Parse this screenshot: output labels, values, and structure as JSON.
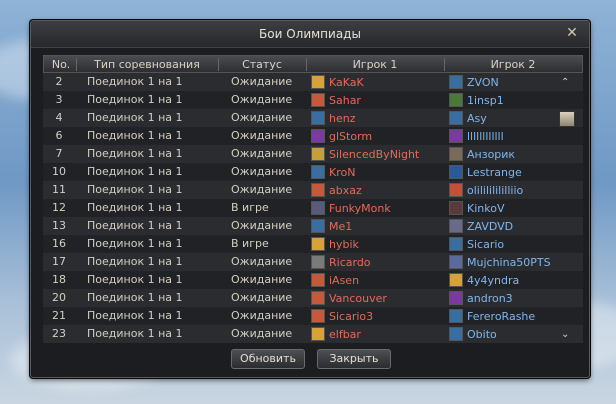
{
  "window": {
    "title": "Бои Олимпиады",
    "close_glyph": "✕"
  },
  "buttons": {
    "refresh": "Обновить",
    "close": "Закрыть"
  },
  "columns": [
    "No.",
    "Тип соревнования",
    "Статус",
    "Игрок 1",
    "Игрок 2"
  ],
  "scrollbar": {
    "up": "⌃",
    "down": "⌄"
  },
  "rows": [
    {
      "no": "2",
      "type": "Поединок 1 на 1",
      "status": "Ожидание",
      "p1": "KaKaK",
      "p2": "ZVON",
      "c1": "#d8a23a",
      "c2": "#3a6ea0"
    },
    {
      "no": "3",
      "type": "Поединок 1 на 1",
      "status": "Ожидание",
      "p1": "Sahar",
      "p2": "1insp1",
      "c1": "#c45a3a",
      "c2": "#4a7a3a"
    },
    {
      "no": "4",
      "type": "Поединок 1 на 1",
      "status": "Ожидание",
      "p1": "henz",
      "p2": "Asy",
      "c1": "#3a6ea0",
      "c2": "#3a6ea0"
    },
    {
      "no": "6",
      "type": "Поединок 1 на 1",
      "status": "Ожидание",
      "p1": "glStorm",
      "p2": "llllllllllll",
      "c1": "#7a3aa0",
      "c2": "#7a3aa0"
    },
    {
      "no": "7",
      "type": "Поединок 1 на 1",
      "status": "Ожидание",
      "p1": "SilencedByNight",
      "p2": "Анзорик",
      "c1": "#c4a03a",
      "c2": "#7a6a5a"
    },
    {
      "no": "10",
      "type": "Поединок 1 на 1",
      "status": "Ожидание",
      "p1": "KroN",
      "p2": "Lestrange",
      "c1": "#3a6ea0",
      "c2": "#2a5a9a"
    },
    {
      "no": "11",
      "type": "Поединок 1 на 1",
      "status": "Ожидание",
      "p1": "abxaz",
      "p2": "olilililililliio",
      "c1": "#c45a3a",
      "c2": "#c4503a"
    },
    {
      "no": "12",
      "type": "Поединок 1 на 1",
      "status": "В игре",
      "p1": "FunkyMonk",
      "p2": "KinkoV",
      "c1": "#5a5a7a",
      "c2": "#5a3a3a"
    },
    {
      "no": "13",
      "type": "Поединок 1 на 1",
      "status": "Ожидание",
      "p1": "Me1",
      "p2": "ZAVDVD",
      "c1": "#3a6ea0",
      "c2": "#6a6a8a"
    },
    {
      "no": "16",
      "type": "Поединок 1 на 1",
      "status": "В игре",
      "p1": "hybik",
      "p2": "Sicario",
      "c1": "#d8a23a",
      "c2": "#3a6ea0"
    },
    {
      "no": "17",
      "type": "Поединок 1 на 1",
      "status": "Ожидание",
      "p1": "Ricardo",
      "p2": "Mujchina50PTS",
      "c1": "#7a7a7a",
      "c2": "#5a6a9a"
    },
    {
      "no": "18",
      "type": "Поединок 1 на 1",
      "status": "Ожидание",
      "p1": "iAsen",
      "p2": "4y4yndra",
      "c1": "#c45a3a",
      "c2": "#d8a23a"
    },
    {
      "no": "20",
      "type": "Поединок 1 на 1",
      "status": "Ожидание",
      "p1": "Vancouver",
      "p2": "andron3",
      "c1": "#c45a3a",
      "c2": "#7a3aa0"
    },
    {
      "no": "21",
      "type": "Поединок 1 на 1",
      "status": "Ожидание",
      "p1": "Sicario3",
      "p2": "FereroRashe",
      "c1": "#c45a3a",
      "c2": "#3a6ea0"
    },
    {
      "no": "23",
      "type": "Поединок 1 на 1",
      "status": "Ожидание",
      "p1": "elfbar",
      "p2": "Obito",
      "c1": "#d8a23a",
      "c2": "#3a6ea0"
    }
  ]
}
